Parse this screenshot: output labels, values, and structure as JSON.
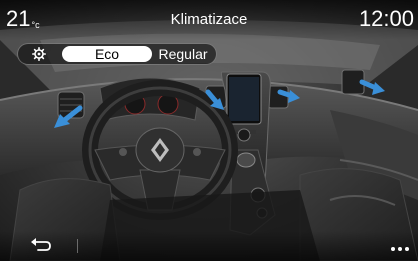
{
  "header": {
    "temperature": "21",
    "temperature_unit": "°c",
    "title": "Klimatizace",
    "clock": "12:00"
  },
  "modes": {
    "settings_icon": "gear-icon",
    "eco_label": "Eco",
    "regular_label": "Regular",
    "selected": "Eco"
  },
  "footer": {
    "back_icon": "back-arrow-icon",
    "more_icon": "more-dots-icon"
  },
  "colors": {
    "airflow_arrow": "#3a8fd8",
    "selected_mode_bg": "#ffffff",
    "text": "#ffffff"
  }
}
